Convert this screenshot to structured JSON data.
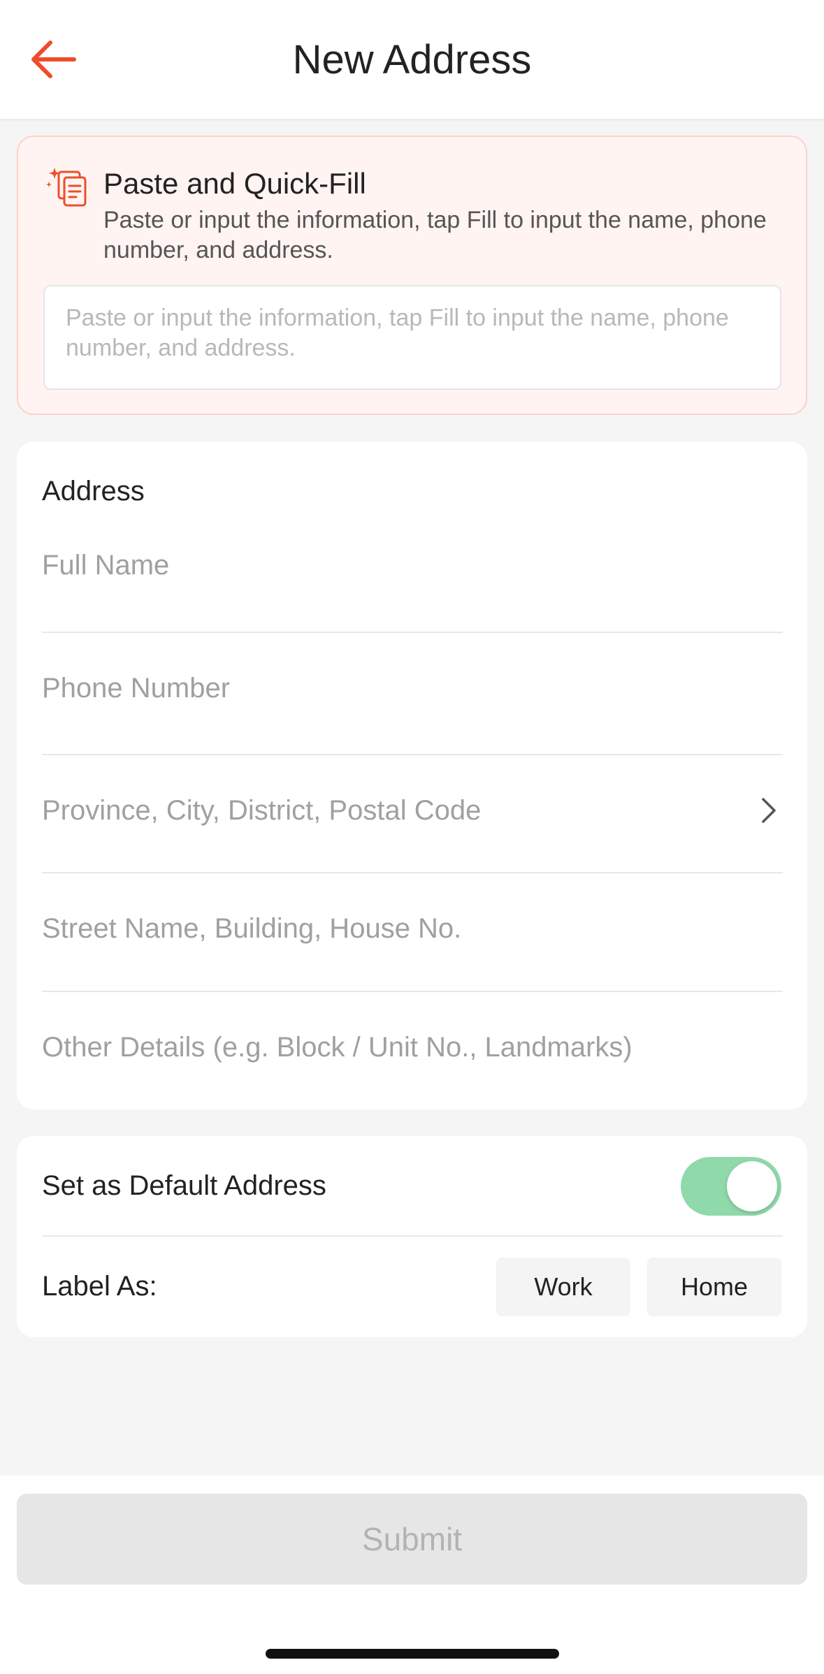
{
  "header": {
    "title": "New Address",
    "back_icon": "arrow-left-icon"
  },
  "quick_fill": {
    "icon": "paste-sparkle-icon",
    "title": "Paste and Quick-Fill",
    "description": "Paste or input the information, tap Fill to input the name, phone number, and address.",
    "input_placeholder": "Paste or input the information, tap Fill to input the name, phone number, and address.",
    "input_value": ""
  },
  "address": {
    "section_title": "Address",
    "full_name_placeholder": "Full Name",
    "phone_placeholder": "Phone Number",
    "region_placeholder": "Province, City, District, Postal Code",
    "street_placeholder": "Street Name, Building, House No.",
    "other_placeholder": "Other Details (e.g. Block / Unit No., Landmarks)"
  },
  "settings": {
    "default_label": "Set as Default Address",
    "default_on": true,
    "label_as": "Label As:",
    "chips": [
      "Work",
      "Home"
    ]
  },
  "footer": {
    "submit_label": "Submit"
  },
  "colors": {
    "accent": "#ee4d2d",
    "toggle_on": "#8fd9ab",
    "quickfill_bg": "#fff4f1",
    "quickfill_border": "#fad3ca",
    "submit_disabled_bg": "#e6e6e6",
    "submit_disabled_text": "#b3b3b3"
  }
}
